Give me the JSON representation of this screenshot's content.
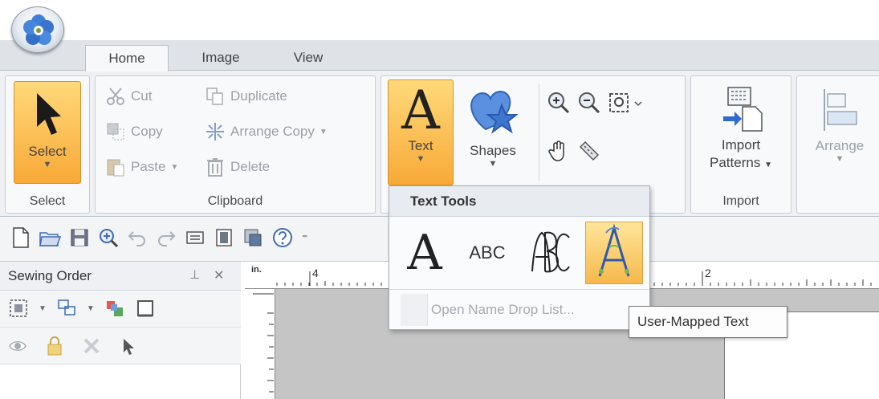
{
  "tabs": [
    {
      "label": "Home",
      "active": true
    },
    {
      "label": "Image",
      "active": false
    },
    {
      "label": "View",
      "active": false
    }
  ],
  "ribbon": {
    "select_group": {
      "button_label": "Select",
      "group_label": "Select"
    },
    "clipboard_group": {
      "group_label": "Clipboard",
      "cut": "Cut",
      "copy": "Copy",
      "paste": "Paste",
      "duplicate": "Duplicate",
      "arrange_copy": "Arrange Copy",
      "delete": "Delete"
    },
    "create_group": {
      "text_label": "Text",
      "shapes_label": "Shapes"
    },
    "import_group": {
      "import_line1": "Import",
      "import_line2": "Patterns",
      "group_label": "Import"
    },
    "arrange_group": {
      "arrange_label": "Arrange"
    }
  },
  "sewing_order": {
    "title": "Sewing Order",
    "pin_glyph": "ᵖ",
    "close_glyph": "✕"
  },
  "ruler": {
    "unit": "in.",
    "mark_4": "4",
    "mark_2": "2"
  },
  "text_tools_menu": {
    "title": "Text Tools",
    "tool_abc": "ABC",
    "open_name_drop_list": "Open Name Drop List..."
  },
  "tooltip": {
    "text": "User-Mapped Text"
  },
  "colors": {
    "accent_orange": "#f8a937",
    "shapes_blue": "#4f86d6",
    "ribbon_bg": "#eef0f3"
  }
}
